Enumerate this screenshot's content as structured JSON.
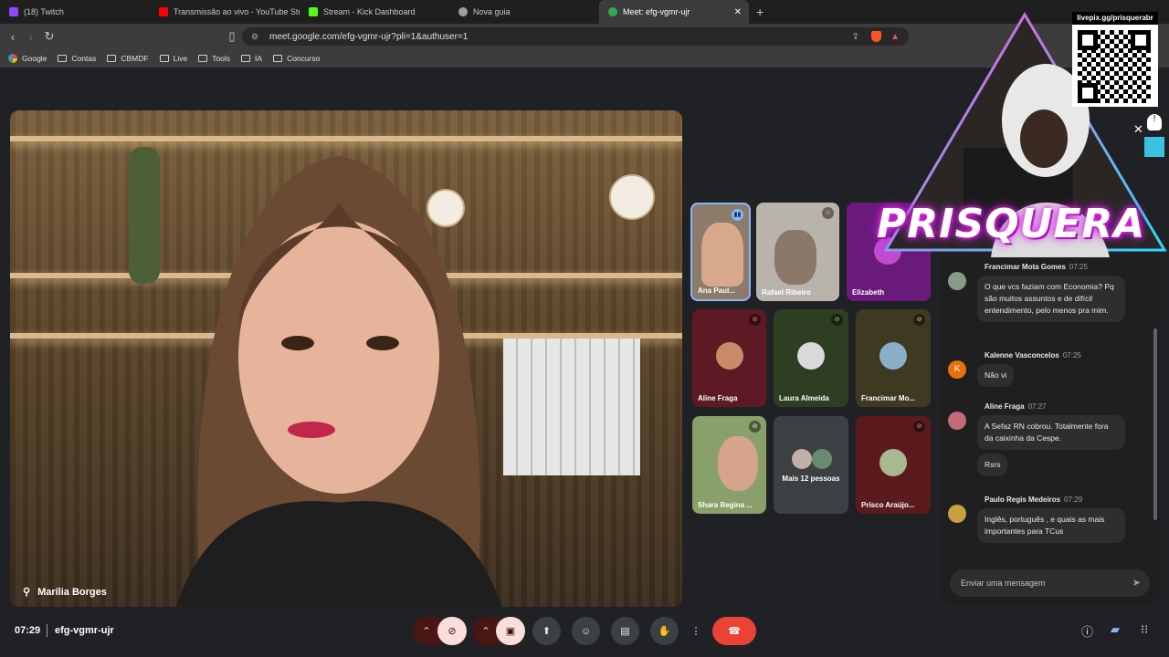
{
  "browser": {
    "tabs": [
      {
        "label": "(18) Twitch",
        "color": "#9146ff"
      },
      {
        "label": "Transmissão ao vivo - YouTube Studio",
        "color": "#ff0000"
      },
      {
        "label": "Stream - Kick Dashboard",
        "color": "#53fc18"
      },
      {
        "label": "Nova guia",
        "color": "#9aa0a6"
      },
      {
        "label": "Meet: efg-vgmr-ujr",
        "color": "#34a853",
        "active": true
      }
    ],
    "new_tab": "+",
    "url": "meet.google.com/efg-vgmr-ujr?pli=1&authuser=1",
    "bookmarks": [
      "Google",
      "Contas",
      "CBMDF",
      "Live",
      "Tools",
      "IA",
      "Concurso"
    ]
  },
  "main_video": {
    "name": "Marília Borges"
  },
  "tiles": [
    {
      "name": "Ana Paul...",
      "state": "speaking"
    },
    {
      "name": "Rafael Ribeiro",
      "state": "muted"
    },
    {
      "name": "Elizabeth",
      "state": "none"
    },
    {
      "name": "Aline Fraga",
      "state": "muted"
    },
    {
      "name": "Laura Almeida",
      "state": "muted"
    },
    {
      "name": "Francimar Mo...",
      "state": "muted"
    },
    {
      "name": "Shara Regina ...",
      "state": "muted"
    },
    {
      "name": "Mais 12 pessoas",
      "state": "none"
    },
    {
      "name": "Prisco Araújo...",
      "state": "muted"
    }
  ],
  "chat": {
    "messages": [
      {
        "author": "Francimar Mota Gomes",
        "time": "07:25",
        "initial": "",
        "texts": [
          "O que vcs faziam com Economia? Pq são muitos assuntos e de difícil entendimento, pelo menos pra mim."
        ]
      },
      {
        "author": "Kalenne Vasconcelos",
        "time": "07:25",
        "initial": "K",
        "texts": [
          "Não vi"
        ]
      },
      {
        "author": "Aline Fraga",
        "time": "07:27",
        "initial": "",
        "texts": [
          "A Sefaz RN cobrou. Totalmente fora da caixinha da Cespe.",
          "Rsrs"
        ]
      },
      {
        "author": "Paulo Regis Medeiros",
        "time": "07:29",
        "initial": "",
        "texts": [
          "Inglês, português , e quais as mais importantes para TCus"
        ]
      }
    ],
    "input_placeholder": "Enviar uma mensagem"
  },
  "bottom_bar": {
    "time": "07:29",
    "meeting_code": "efg-vgmr-ujr"
  },
  "overlay": {
    "brand": "PRISQUERA",
    "qr_label": "livepix.gg/prisquerabr"
  },
  "colors": {
    "end_call": "#ea4335",
    "accent_speaking": "#8ab4f8",
    "brand_glow": "#ff2fd0"
  }
}
